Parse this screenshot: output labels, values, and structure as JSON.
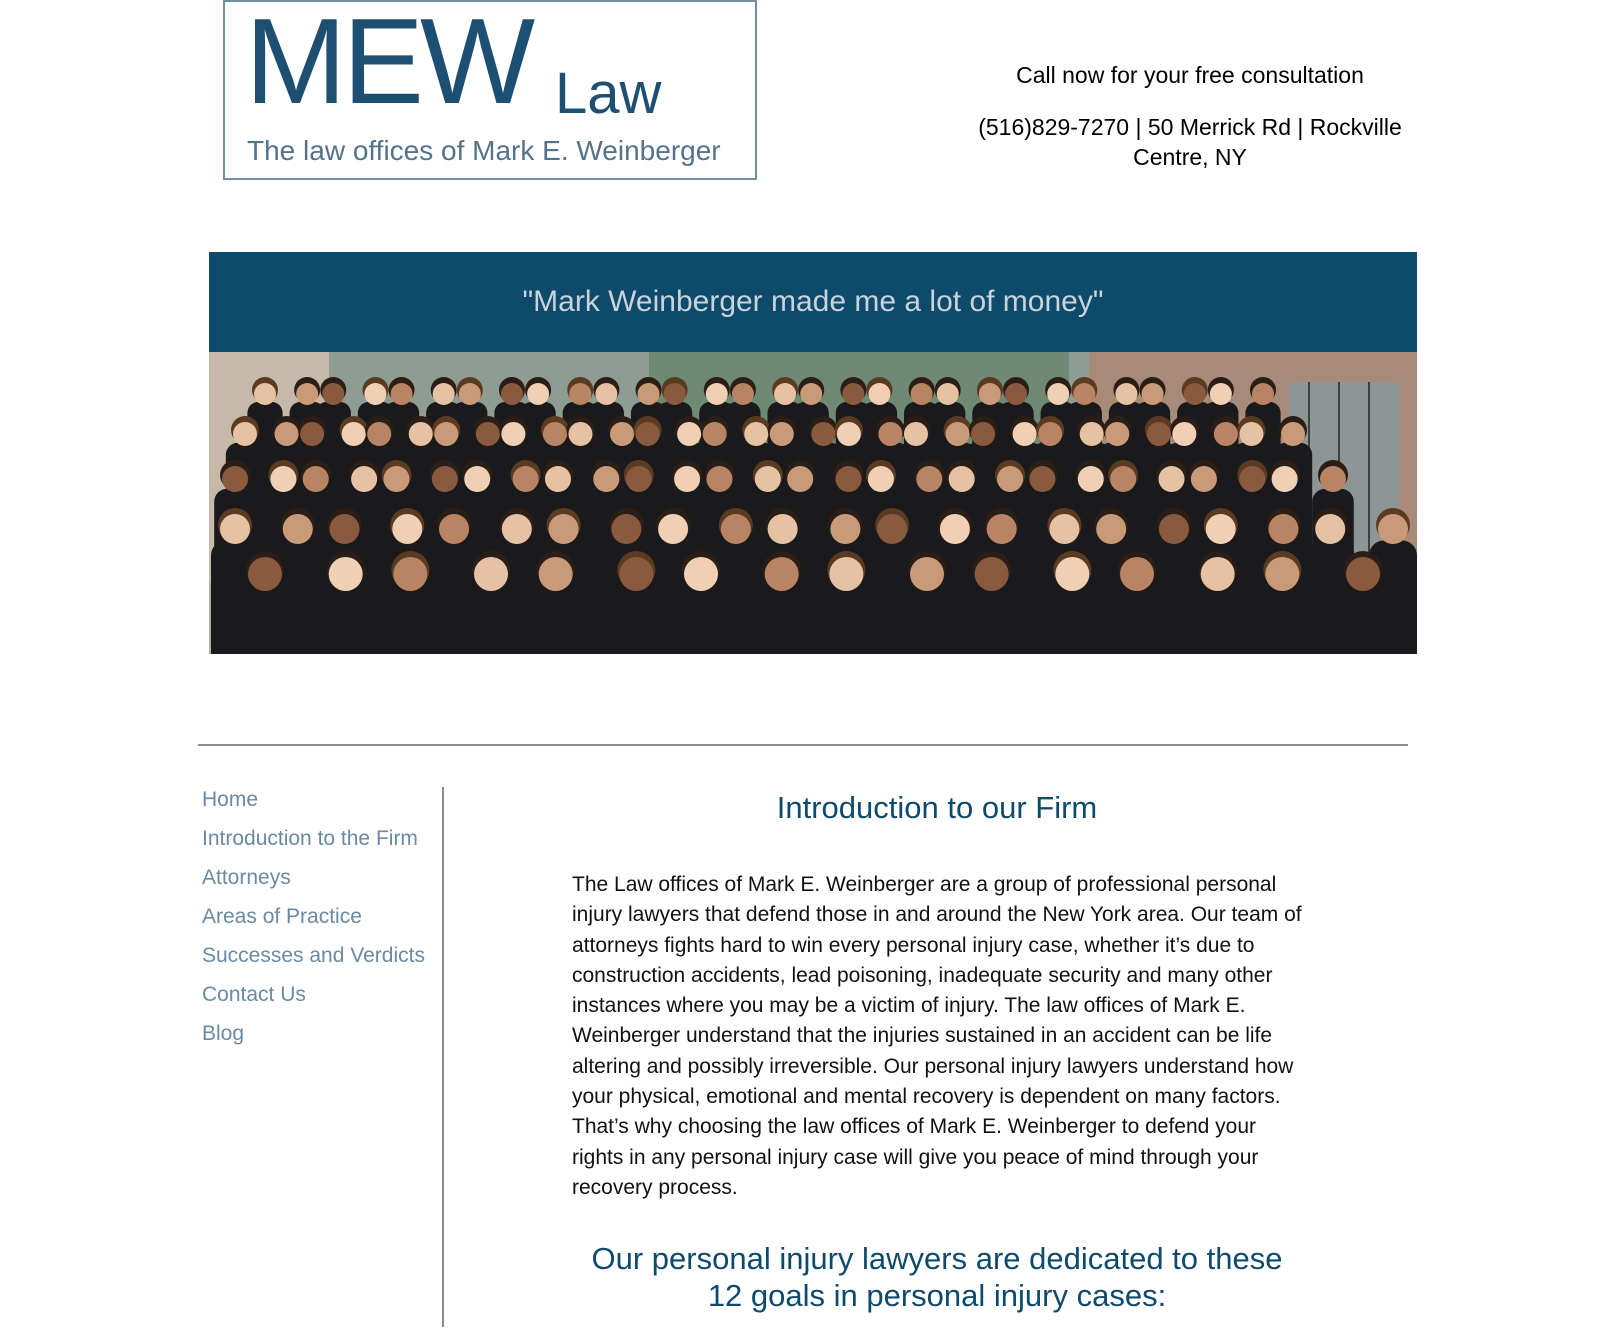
{
  "logo": {
    "brand": "MEW",
    "brand_suffix": "Law",
    "tagline": "The law offices of Mark E. Weinberger"
  },
  "contact": {
    "cta": "Call now for your free consultation",
    "address": "(516)829-7270 | 50 Merrick Rd | Rockville Centre, NY"
  },
  "banner": {
    "quote": "\"Mark Weinberger made me a lot of money\""
  },
  "nav": {
    "items": [
      {
        "label": "Home"
      },
      {
        "label": "Introduction to the Firm"
      },
      {
        "label": "Attorneys"
      },
      {
        "label": "Areas of Practice"
      },
      {
        "label": "Successes and Verdicts"
      },
      {
        "label": "Contact Us"
      },
      {
        "label": "Blog"
      }
    ]
  },
  "main": {
    "title": "Introduction to our Firm",
    "body": "The Law offices of Mark E. Weinberger are a group of professional personal injury lawyers that defend those in and around the New York area. Our team of attorneys fights hard to win every personal injury case, whether it’s due to construction accidents, lead poisoning, inadequate security and many other instances where you may be a victim of injury. The law offices of Mark E. Weinberger understand that the injuries sustained in an accident can be life altering and possibly irreversible. Our personal injury lawyers understand how your physical, emotional and mental recovery is dependent on many factors. That’s why choosing the law offices of Mark E. Weinberger to defend your rights in any personal injury case will give you peace of mind through your recovery process.",
    "subheading": "Our personal injury lawyers are dedicated to these 12 goals in personal injury cases:"
  },
  "colors": {
    "brand_blue": "#0e4a6c",
    "nav_link": "#6a8aa3",
    "banner_text": "#c9d3da"
  }
}
